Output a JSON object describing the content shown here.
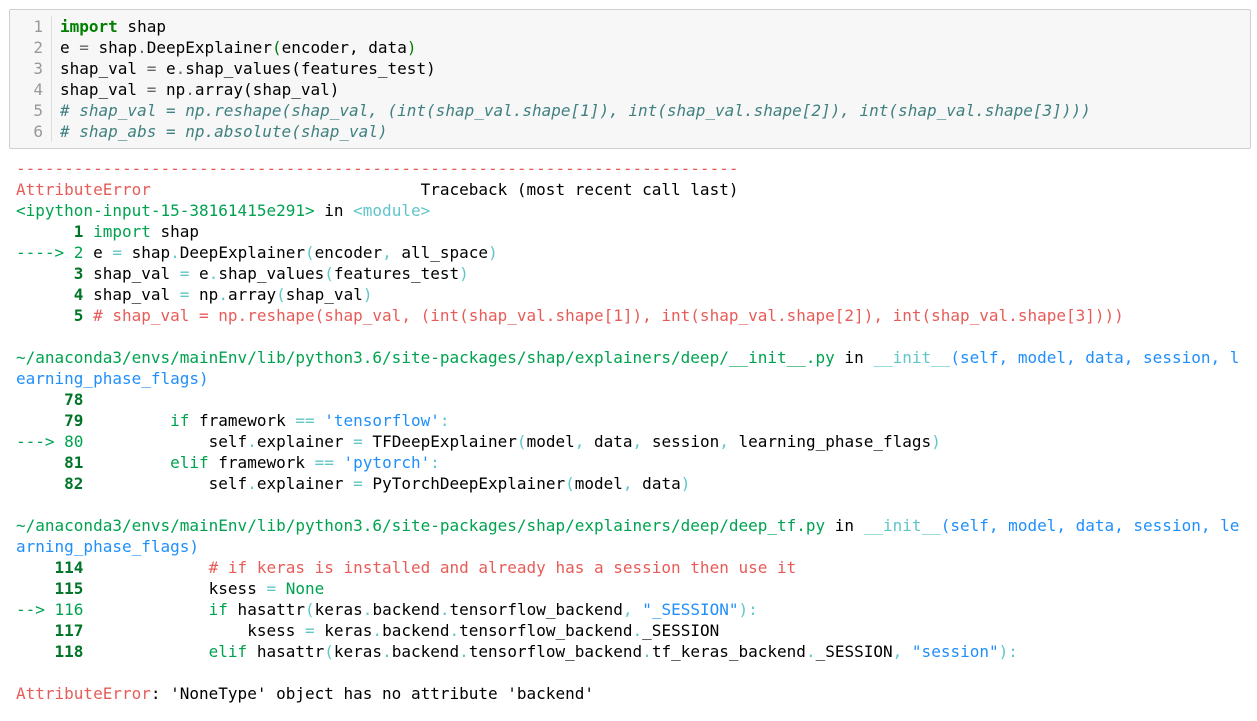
{
  "input_cell": {
    "lines": [
      {
        "num": "1",
        "parts": [
          {
            "t": "import",
            "c": "kw"
          },
          {
            "t": " shap",
            "c": ""
          }
        ]
      },
      {
        "num": "2",
        "parts": [
          {
            "t": "e ",
            "c": ""
          },
          {
            "t": "=",
            "c": "op"
          },
          {
            "t": " shap",
            "c": ""
          },
          {
            "t": ".",
            "c": "op"
          },
          {
            "t": "DeepExplainer",
            "c": ""
          },
          {
            "t": "(",
            "c": "paren-hl"
          },
          {
            "t": "encoder, data",
            "c": ""
          },
          {
            "t": ")",
            "c": "paren-hl"
          }
        ]
      },
      {
        "num": "3",
        "parts": [
          {
            "t": "shap_val ",
            "c": ""
          },
          {
            "t": "=",
            "c": "op"
          },
          {
            "t": " e",
            "c": ""
          },
          {
            "t": ".",
            "c": "op"
          },
          {
            "t": "shap_values(features_test)",
            "c": ""
          }
        ]
      },
      {
        "num": "4",
        "parts": [
          {
            "t": "shap_val ",
            "c": ""
          },
          {
            "t": "=",
            "c": "op"
          },
          {
            "t": " np",
            "c": ""
          },
          {
            "t": ".",
            "c": "op"
          },
          {
            "t": "array(shap_val)",
            "c": ""
          }
        ]
      },
      {
        "num": "5",
        "parts": [
          {
            "t": "# shap_val = np.reshape(shap_val, (int(shap_val.shape[1]), int(shap_val.shape[2]), int(shap_val.shape[3])))",
            "c": "com"
          }
        ]
      },
      {
        "num": "6",
        "parts": [
          {
            "t": "# shap_abs = np.absolute(shap_val)",
            "c": "com"
          }
        ]
      }
    ]
  },
  "output": {
    "lines": [
      [
        {
          "t": "---------------------------------------------------------------------------",
          "c": "red"
        }
      ],
      [
        {
          "t": "AttributeError",
          "c": "red"
        },
        {
          "t": "                            Traceback (most recent call last)",
          "c": ""
        }
      ],
      [
        {
          "t": "<ipython-input-15-38161415e291>",
          "c": "green"
        },
        {
          "t": " in ",
          "c": ""
        },
        {
          "t": "<module>",
          "c": "cyan"
        }
      ],
      [
        {
          "t": "      1 ",
          "c": "dgreen"
        },
        {
          "t": "import",
          "c": "green"
        },
        {
          "t": " shap",
          "c": ""
        }
      ],
      [
        {
          "t": "----> 2 ",
          "c": "green"
        },
        {
          "t": "e ",
          "c": ""
        },
        {
          "t": "=",
          "c": "cyan"
        },
        {
          "t": " shap",
          "c": ""
        },
        {
          "t": ".",
          "c": "cyan"
        },
        {
          "t": "DeepExplainer",
          "c": ""
        },
        {
          "t": "(",
          "c": "cyan"
        },
        {
          "t": "encoder",
          "c": ""
        },
        {
          "t": ",",
          "c": "cyan"
        },
        {
          "t": " all_space",
          "c": ""
        },
        {
          "t": ")",
          "c": "cyan"
        }
      ],
      [
        {
          "t": "      3 ",
          "c": "dgreen"
        },
        {
          "t": "shap_val ",
          "c": ""
        },
        {
          "t": "=",
          "c": "cyan"
        },
        {
          "t": " e",
          "c": ""
        },
        {
          "t": ".",
          "c": "cyan"
        },
        {
          "t": "shap_values",
          "c": ""
        },
        {
          "t": "(",
          "c": "cyan"
        },
        {
          "t": "features_test",
          "c": ""
        },
        {
          "t": ")",
          "c": "cyan"
        }
      ],
      [
        {
          "t": "      4 ",
          "c": "dgreen"
        },
        {
          "t": "shap_val ",
          "c": ""
        },
        {
          "t": "=",
          "c": "cyan"
        },
        {
          "t": " np",
          "c": ""
        },
        {
          "t": ".",
          "c": "cyan"
        },
        {
          "t": "array",
          "c": ""
        },
        {
          "t": "(",
          "c": "cyan"
        },
        {
          "t": "shap_val",
          "c": ""
        },
        {
          "t": ")",
          "c": "cyan"
        }
      ],
      [
        {
          "t": "      5 ",
          "c": "dgreen"
        },
        {
          "t": "# shap_val = np.reshape(shap_val, (int(shap_val.shape[1]), int(shap_val.shape[2]), int(shap_val.shape[3])))",
          "c": "red"
        }
      ],
      [],
      [
        {
          "t": "~/anaconda3/envs/mainEnv/lib/python3.6/site-packages/shap/explainers/deep/__init__.py",
          "c": "green"
        },
        {
          "t": " in ",
          "c": ""
        },
        {
          "t": "__init__",
          "c": "cyan"
        },
        {
          "t": "(self, model, data, session, l",
          "c": "blue"
        }
      ],
      [
        {
          "t": "earning_phase_flags)",
          "c": "blue"
        }
      ],
      [
        {
          "t": "     78 ",
          "c": "dgreen"
        }
      ],
      [
        {
          "t": "     79 ",
          "c": "dgreen"
        },
        {
          "t": "        if",
          "c": "green"
        },
        {
          "t": " framework ",
          "c": ""
        },
        {
          "t": "==",
          "c": "cyan"
        },
        {
          "t": " ",
          "c": ""
        },
        {
          "t": "'tensorflow'",
          "c": "blue"
        },
        {
          "t": ":",
          "c": "cyan"
        }
      ],
      [
        {
          "t": "---> 80 ",
          "c": "green"
        },
        {
          "t": "            self",
          "c": ""
        },
        {
          "t": ".",
          "c": "cyan"
        },
        {
          "t": "explainer ",
          "c": ""
        },
        {
          "t": "=",
          "c": "cyan"
        },
        {
          "t": " TFDeepExplainer",
          "c": ""
        },
        {
          "t": "(",
          "c": "cyan"
        },
        {
          "t": "model",
          "c": ""
        },
        {
          "t": ",",
          "c": "cyan"
        },
        {
          "t": " data",
          "c": ""
        },
        {
          "t": ",",
          "c": "cyan"
        },
        {
          "t": " session",
          "c": ""
        },
        {
          "t": ",",
          "c": "cyan"
        },
        {
          "t": " learning_phase_flags",
          "c": ""
        },
        {
          "t": ")",
          "c": "cyan"
        }
      ],
      [
        {
          "t": "     81 ",
          "c": "dgreen"
        },
        {
          "t": "        elif",
          "c": "green"
        },
        {
          "t": " framework ",
          "c": ""
        },
        {
          "t": "==",
          "c": "cyan"
        },
        {
          "t": " ",
          "c": ""
        },
        {
          "t": "'pytorch'",
          "c": "blue"
        },
        {
          "t": ":",
          "c": "cyan"
        }
      ],
      [
        {
          "t": "     82 ",
          "c": "dgreen"
        },
        {
          "t": "            self",
          "c": ""
        },
        {
          "t": ".",
          "c": "cyan"
        },
        {
          "t": "explainer ",
          "c": ""
        },
        {
          "t": "=",
          "c": "cyan"
        },
        {
          "t": " PyTorchDeepExplainer",
          "c": ""
        },
        {
          "t": "(",
          "c": "cyan"
        },
        {
          "t": "model",
          "c": ""
        },
        {
          "t": ",",
          "c": "cyan"
        },
        {
          "t": " data",
          "c": ""
        },
        {
          "t": ")",
          "c": "cyan"
        }
      ],
      [],
      [
        {
          "t": "~/anaconda3/envs/mainEnv/lib/python3.6/site-packages/shap/explainers/deep/deep_tf.py",
          "c": "green"
        },
        {
          "t": " in ",
          "c": ""
        },
        {
          "t": "__init__",
          "c": "cyan"
        },
        {
          "t": "(self, model, data, session, le",
          "c": "blue"
        }
      ],
      [
        {
          "t": "arning_phase_flags)",
          "c": "blue"
        }
      ],
      [
        {
          "t": "    114 ",
          "c": "dgreen"
        },
        {
          "t": "            # if keras is installed and already has a session then use it",
          "c": "red"
        }
      ],
      [
        {
          "t": "    115 ",
          "c": "dgreen"
        },
        {
          "t": "            ksess ",
          "c": ""
        },
        {
          "t": "=",
          "c": "cyan"
        },
        {
          "t": " None",
          "c": "green"
        }
      ],
      [
        {
          "t": "--> 116 ",
          "c": "green"
        },
        {
          "t": "            if",
          "c": "green"
        },
        {
          "t": " hasattr",
          "c": ""
        },
        {
          "t": "(",
          "c": "cyan"
        },
        {
          "t": "keras",
          "c": ""
        },
        {
          "t": ".",
          "c": "cyan"
        },
        {
          "t": "backend",
          "c": ""
        },
        {
          "t": ".",
          "c": "cyan"
        },
        {
          "t": "tensorflow_backend",
          "c": ""
        },
        {
          "t": ",",
          "c": "cyan"
        },
        {
          "t": " ",
          "c": ""
        },
        {
          "t": "\"_SESSION\"",
          "c": "blue"
        },
        {
          "t": ")",
          "c": "cyan"
        },
        {
          "t": ":",
          "c": "cyan"
        }
      ],
      [
        {
          "t": "    117 ",
          "c": "dgreen"
        },
        {
          "t": "                ksess ",
          "c": ""
        },
        {
          "t": "=",
          "c": "cyan"
        },
        {
          "t": " keras",
          "c": ""
        },
        {
          "t": ".",
          "c": "cyan"
        },
        {
          "t": "backend",
          "c": ""
        },
        {
          "t": ".",
          "c": "cyan"
        },
        {
          "t": "tensorflow_backend",
          "c": ""
        },
        {
          "t": ".",
          "c": "cyan"
        },
        {
          "t": "_SESSION",
          "c": ""
        }
      ],
      [
        {
          "t": "    118 ",
          "c": "dgreen"
        },
        {
          "t": "            elif",
          "c": "green"
        },
        {
          "t": " hasattr",
          "c": ""
        },
        {
          "t": "(",
          "c": "cyan"
        },
        {
          "t": "keras",
          "c": ""
        },
        {
          "t": ".",
          "c": "cyan"
        },
        {
          "t": "backend",
          "c": ""
        },
        {
          "t": ".",
          "c": "cyan"
        },
        {
          "t": "tensorflow_backend",
          "c": ""
        },
        {
          "t": ".",
          "c": "cyan"
        },
        {
          "t": "tf_keras_backend",
          "c": ""
        },
        {
          "t": ".",
          "c": "cyan"
        },
        {
          "t": "_SESSION",
          "c": ""
        },
        {
          "t": ",",
          "c": "cyan"
        },
        {
          "t": " ",
          "c": ""
        },
        {
          "t": "\"session\"",
          "c": "blue"
        },
        {
          "t": ")",
          "c": "cyan"
        },
        {
          "t": ":",
          "c": "cyan"
        }
      ],
      [],
      [
        {
          "t": "AttributeError",
          "c": "red"
        },
        {
          "t": ": 'NoneType' object has no attribute 'backend'",
          "c": ""
        }
      ]
    ]
  }
}
